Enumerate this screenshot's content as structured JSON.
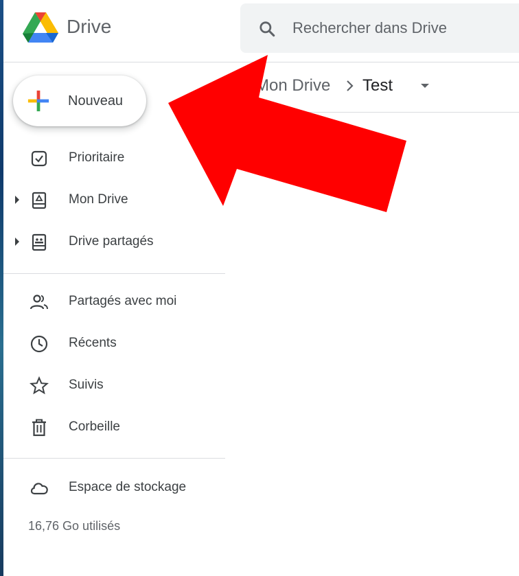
{
  "app": {
    "name": "Drive"
  },
  "search": {
    "placeholder": "Rechercher dans Drive"
  },
  "breadcrumb": {
    "root": "Mon Drive",
    "current": "Test"
  },
  "new_button": {
    "label": "Nouveau"
  },
  "sidebar": {
    "items": [
      {
        "label": "Prioritaire",
        "icon": "priority-check-icon",
        "expandable": false
      },
      {
        "label": "Mon Drive",
        "icon": "my-drive-icon",
        "expandable": true
      },
      {
        "label": "Drive partagés",
        "icon": "shared-drives-icon",
        "expandable": true
      },
      {
        "label": "Partagés avec moi",
        "icon": "people-icon",
        "expandable": false
      },
      {
        "label": "Récents",
        "icon": "clock-icon",
        "expandable": false
      },
      {
        "label": "Suivis",
        "icon": "star-icon",
        "expandable": false
      },
      {
        "label": "Corbeille",
        "icon": "trash-icon",
        "expandable": false
      },
      {
        "label": "Espace de stockage",
        "icon": "cloud-icon",
        "expandable": false
      }
    ]
  },
  "storage": {
    "used": "16,76 Go utilisés"
  },
  "annotation": {
    "icon": "red-arrow-icon",
    "color": "#ff0000"
  },
  "colors": {
    "google_blue": "#4285f4",
    "google_red": "#ea4335",
    "google_yellow": "#fbbc04",
    "google_green": "#34a853",
    "icon_gray": "#5f6368"
  }
}
